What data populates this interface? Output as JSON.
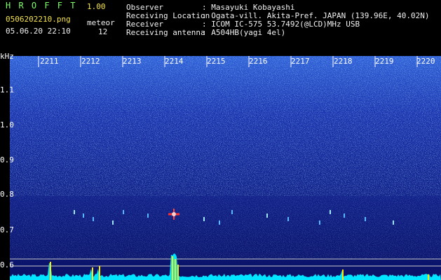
{
  "app": {
    "name": "H R O F F T",
    "version": "1.00",
    "filename": "0506202210.png",
    "datetime": "05.06.20 22:10",
    "meteor_label": "meteor",
    "meteor_count": "12"
  },
  "info": {
    "observer_label": "Observer",
    "observer_value": ": Masayuki Kobayashi",
    "location_label": "Receiving Location",
    "location_value": ": Ogata-vill. Akita-Pref. JAPAN (139.96E, 40.02N)",
    "receiver_label": "Receiver",
    "receiver_value": ": ICOM IC-575 53.7492(@LCD)MHz USB",
    "antenna_label": "Receiving antenna",
    "antenna_value": ": A504HB(yagi 4el)"
  },
  "chart_data": {
    "type": "heatmap",
    "ylabel": "kHz",
    "time_ticks": [
      "2211",
      "2212",
      "2213",
      "2214",
      "2215",
      "2216",
      "2217",
      "2218",
      "2219",
      "2220"
    ],
    "freq_ticks": [
      "1.1",
      "1.0",
      "0.9",
      "0.8",
      "0.7",
      "0.6"
    ],
    "freq_values": [
      1.1,
      1.0,
      0.9,
      0.8,
      0.7,
      0.6
    ],
    "colors": {
      "background": "#10208a",
      "noise_bright": "#4fb6ff",
      "meteor": "#ff3030",
      "trace": "#00e5ff",
      "peak": "#ffe600"
    }
  }
}
